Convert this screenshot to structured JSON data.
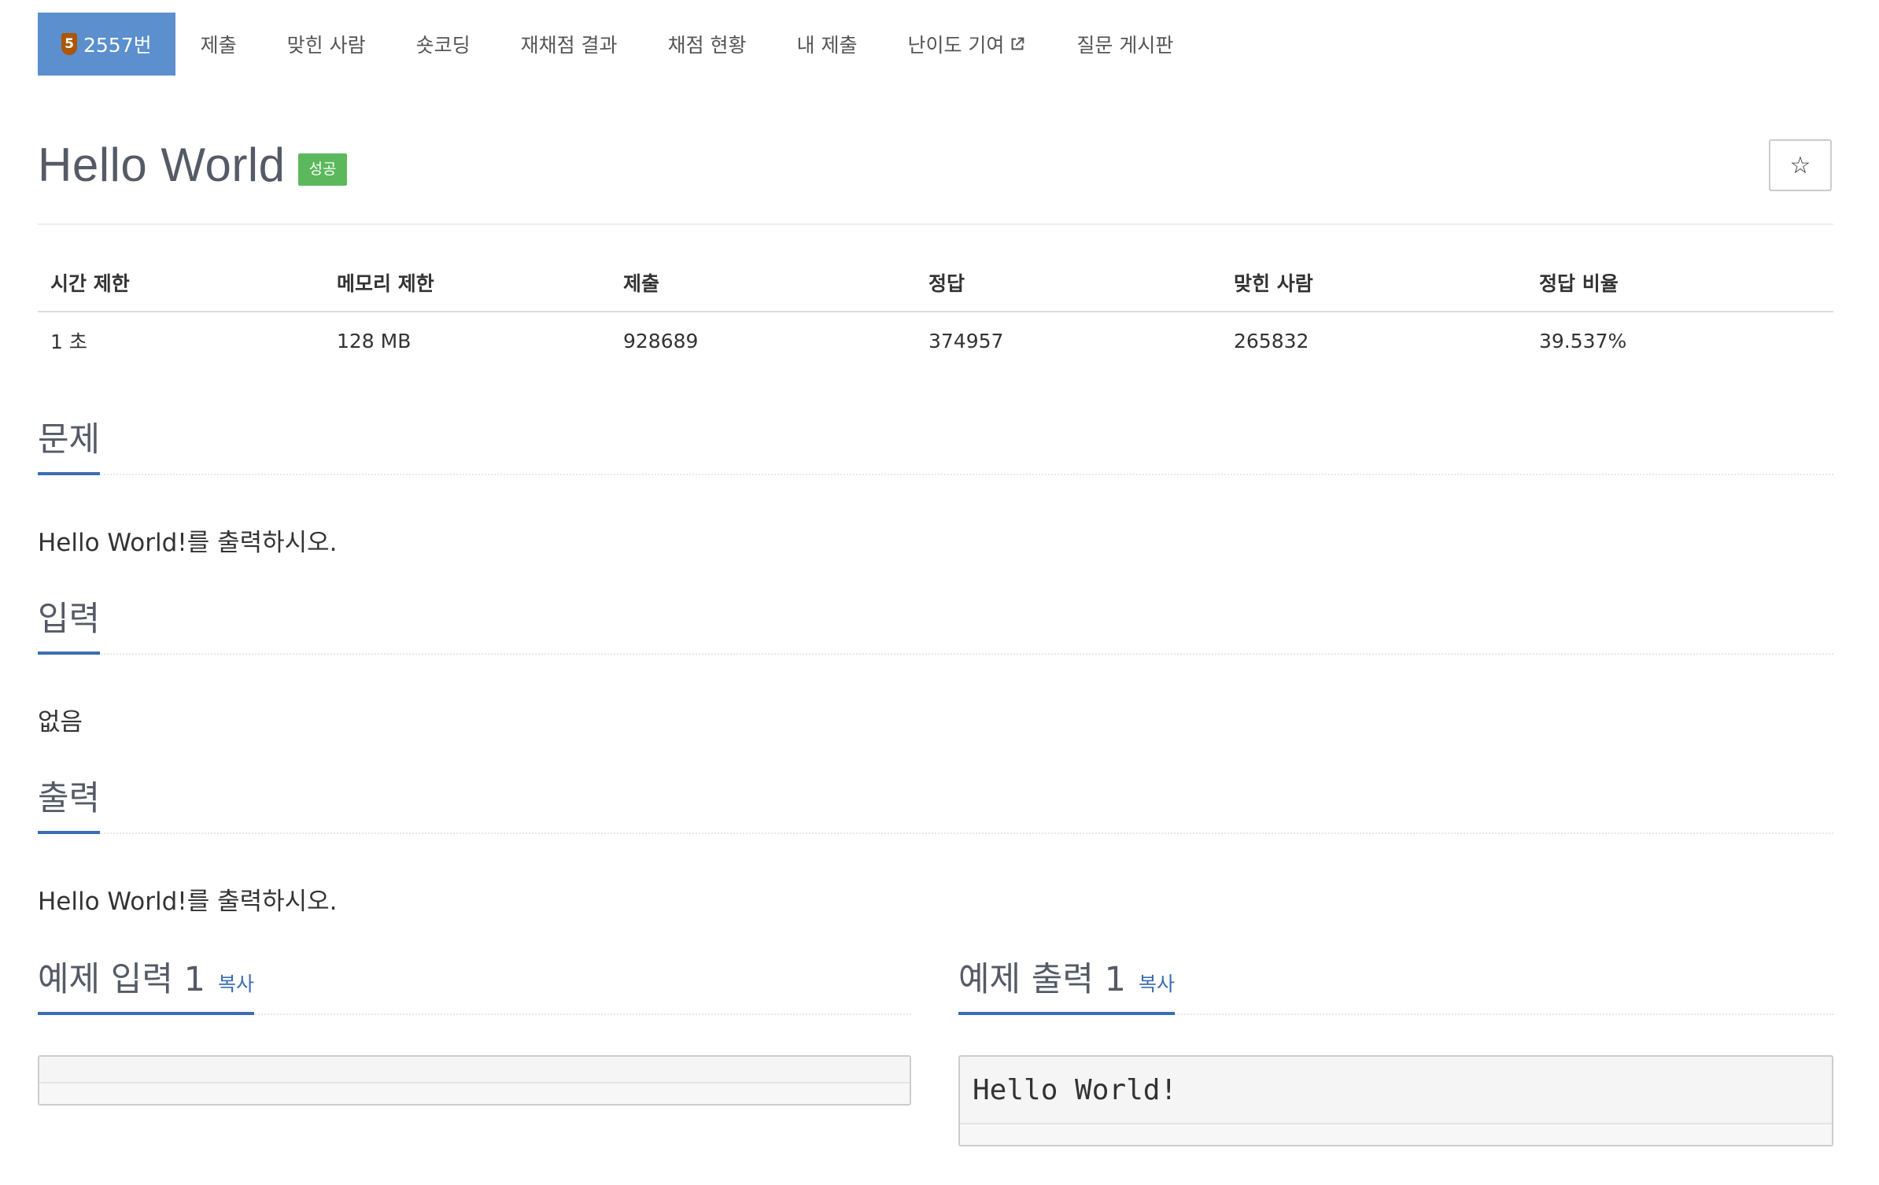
{
  "nav": {
    "tier_badge": "5",
    "problem_tab": "2557번",
    "tabs": [
      "제출",
      "맞힌 사람",
      "숏코딩",
      "재채점 결과",
      "채점 현황",
      "내 제출"
    ],
    "difficulty_tab": "난이도 기여",
    "board_tab": "질문 게시판"
  },
  "problem": {
    "title": "Hello World",
    "status": "성공",
    "star_icon": "☆"
  },
  "info_table": {
    "headers": [
      "시간 제한",
      "메모리 제한",
      "제출",
      "정답",
      "맞힌 사람",
      "정답 비율"
    ],
    "values": [
      "1 초",
      "128 MB",
      "928689",
      "374957",
      "265832",
      "39.537%"
    ]
  },
  "sections": {
    "description": {
      "title": "문제",
      "body": "Hello World!를 출력하시오."
    },
    "input": {
      "title": "입력",
      "body": "없음"
    },
    "output": {
      "title": "출력",
      "body": "Hello World!를 출력하시오."
    },
    "sample_input": {
      "title": "예제 입력 1",
      "copy": "복사",
      "content": ""
    },
    "sample_output": {
      "title": "예제 출력 1",
      "copy": "복사",
      "content": "Hello World!"
    }
  },
  "colors": {
    "accent": "#5b8fcd",
    "link": "#3b6db3",
    "success": "#5cb85c",
    "tier_bronze": "#ad5600"
  }
}
